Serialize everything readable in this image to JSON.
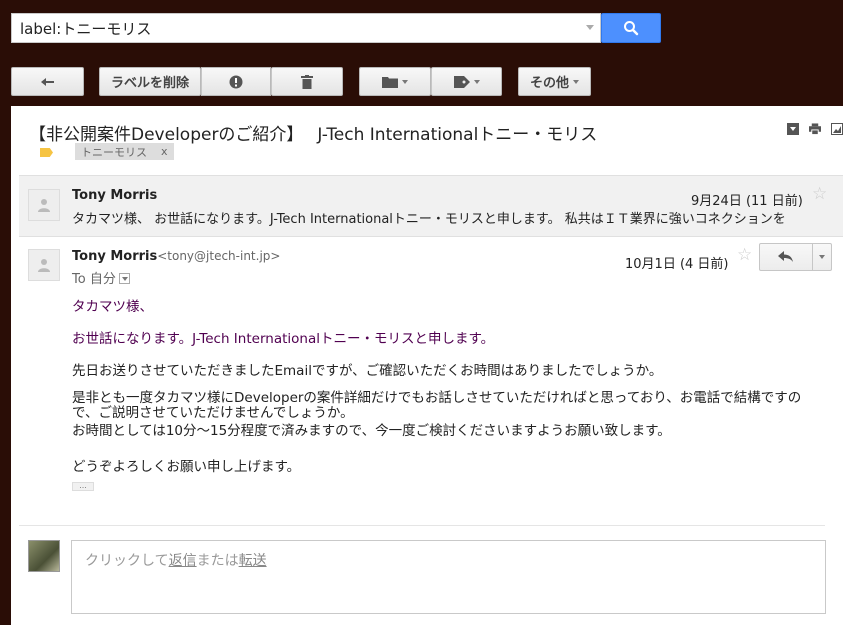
{
  "search": {
    "value": "label:トニーモリス"
  },
  "toolbar": {
    "back_icon": "arrow-left-icon",
    "remove_label": "ラベルを削除",
    "spam_icon": "exclamation-icon",
    "delete_icon": "trash-icon",
    "move_icon": "folder-icon",
    "labels_icon": "tag-icon",
    "more_label": "その他"
  },
  "thread": {
    "subject": "【非公開案件Developerのご紹介】　 J-Tech Internationalトニー・モリス",
    "label_chip": "トニーモリス",
    "label_chip_close": "x"
  },
  "messages": [
    {
      "sender": "Tony Morris",
      "date": "9月24日 (11 日前)",
      "snippet": "タカマツ様、 お世話になります。J-Tech Internationalトニー・モリスと申します。 私共はＩＴ業界に強いコネクションを"
    },
    {
      "sender": "Tony Morris",
      "email": "<tony@jtech-int.jp>",
      "to": "To 自分",
      "date": "10月1日 (4 日前)",
      "body": {
        "greeting": "タカマツ様、",
        "intro": "お世話になります。J-Tech Internationalトニー・モリスと申します。",
        "line1": "先日お送りさせていただきましたEmailですが、ご確認いただくお時間はありましたでしょうか。",
        "line2": "是非とも一度タカマツ様にDeveloperの案件詳細だけでもお話しさせていただければと思っており、お電話で結構ですので、ご説明させていただけませんでしょうか。",
        "line3": "お時間としては10分〜15分程度で済みますので、今一度ご検討くださいますようお願い致します。",
        "closing": "どうぞよろしくお願い申し上げます。",
        "trimmed": "..."
      }
    }
  ],
  "reply": {
    "prefix": "クリックして",
    "reply_link": "返信",
    "middle": "または",
    "forward_link": "転送"
  }
}
